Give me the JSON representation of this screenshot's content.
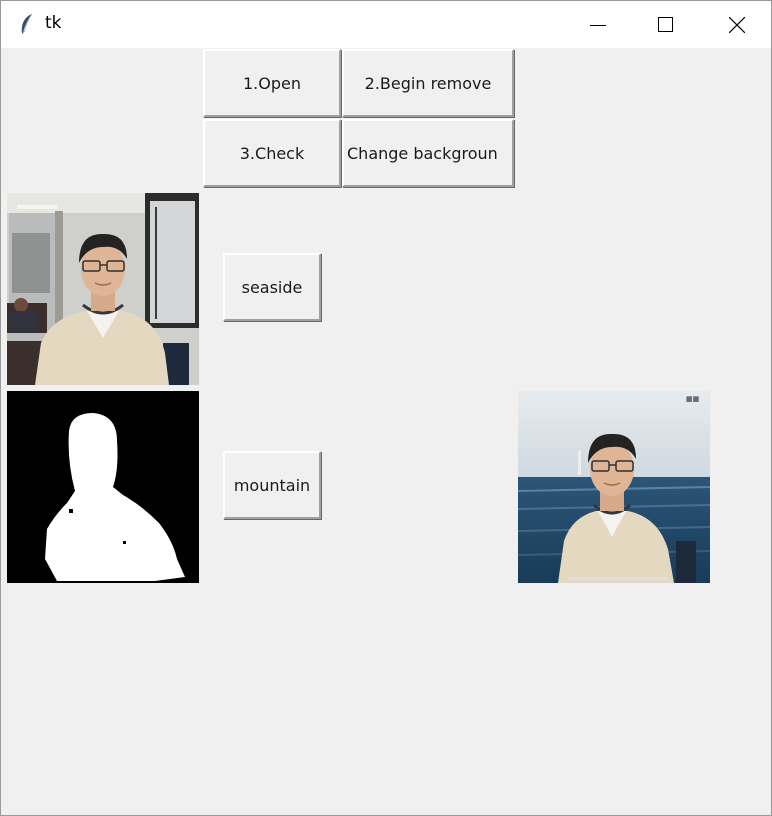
{
  "window": {
    "title": "tk",
    "controls": {
      "minimize_icon": "minimize-icon",
      "maximize_icon": "maximize-icon",
      "close_icon": "close-icon"
    }
  },
  "toolbar": {
    "open_label": "1.Open",
    "begin_remove_label": "2.Begin remove",
    "check_label": "3.Check",
    "change_background_label": "Change backgroun"
  },
  "backgrounds": {
    "seaside_label": "seaside",
    "mountain_label": "mountain"
  },
  "images": {
    "original": "original-photo",
    "mask": "segmentation-mask",
    "result": "seaside-composite"
  },
  "colors": {
    "window_bg": "#f0f0f0",
    "titlebar_bg": "#ffffff",
    "mask_bg": "#000000",
    "mask_fg": "#ffffff"
  }
}
